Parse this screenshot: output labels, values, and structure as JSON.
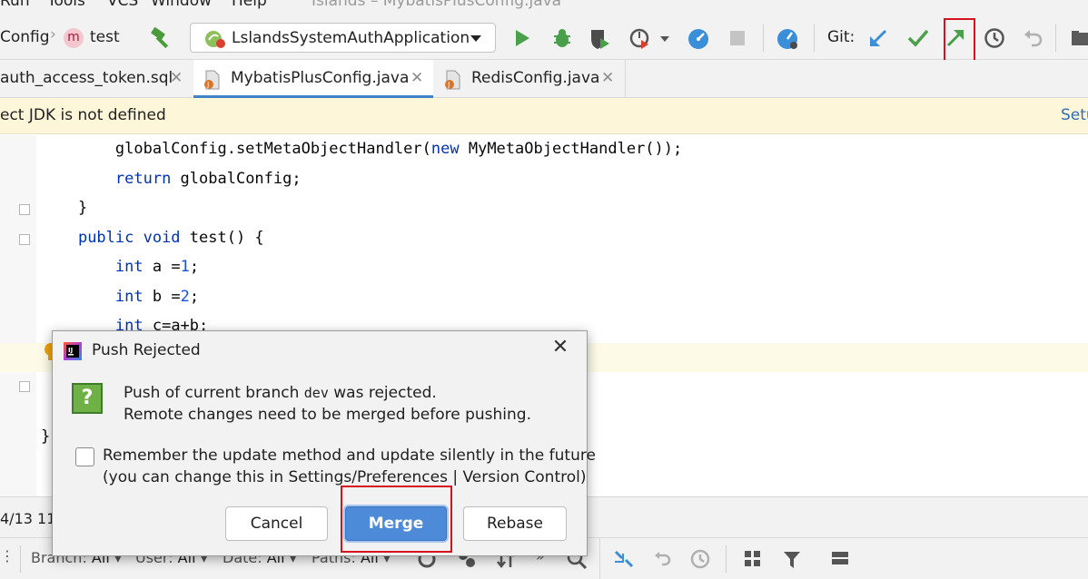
{
  "menu": {
    "items": [
      "Run",
      "Tools",
      "VCS",
      "Window",
      "Help"
    ],
    "window_title": "Islands – MybatisPlusConfig.java"
  },
  "toolbar": {
    "breadcrumb": [
      "Config",
      "test"
    ],
    "method_badge": "m",
    "run_config": "LslandsSystemAuthApplication",
    "git_label": "Git:"
  },
  "tabs": [
    {
      "label": "auth_access_token.sql",
      "active": false
    },
    {
      "label": "MybatisPlusConfig.java",
      "active": true
    },
    {
      "label": "RedisConfig.java",
      "active": false
    }
  ],
  "banner": {
    "message": "ect JDK is not defined",
    "link": "Setu"
  },
  "editor": {
    "lines": [
      {
        "indent": "        ",
        "parts": [
          [
            "",
            "globalConfig.setMetaObjectHandler("
          ],
          [
            "kw",
            "new"
          ],
          [
            "",
            " MyMetaObjectHandler());"
          ]
        ]
      },
      {
        "indent": "        ",
        "parts": [
          [
            "kw",
            "return"
          ],
          [
            "",
            " globalConfig;"
          ]
        ]
      },
      {
        "indent": "    ",
        "parts": [
          [
            "",
            "}"
          ]
        ]
      },
      {
        "indent": "    ",
        "parts": [
          [
            "kw",
            "public void"
          ],
          [
            "",
            " test() {"
          ]
        ]
      },
      {
        "indent": "        ",
        "parts": [
          [
            "kw",
            "int"
          ],
          [
            "",
            " a ="
          ],
          [
            "num",
            "1"
          ],
          [
            "",
            ";"
          ]
        ]
      },
      {
        "indent": "        ",
        "parts": [
          [
            "kw",
            "int"
          ],
          [
            "",
            " b ="
          ],
          [
            "num",
            "2"
          ],
          [
            "",
            ";"
          ]
        ]
      },
      {
        "indent": "        ",
        "parts": [
          [
            "kw",
            "int"
          ],
          [
            "",
            " c=a+b;"
          ]
        ]
      },
      {
        "indent": "",
        "parts": [
          [
            "",
            "}"
          ]
        ]
      }
    ]
  },
  "dialog": {
    "title": "Push Rejected",
    "message_prefix": "Push of current branch ",
    "branch": "dev",
    "message_suffix": " was rejected.",
    "message_line2": "Remote changes need to be merged before pushing.",
    "checkbox_line1": "Remember the update method and update silently in the future",
    "checkbox_line2": "(you can change this in Settings/Preferences | Version Control)",
    "checkbox_checked": false,
    "buttons": {
      "cancel": "Cancel",
      "merge": "Merge",
      "rebase": "Rebase"
    }
  },
  "bottom": {
    "date_fragment": "4/13 11",
    "filters": [
      {
        "name": "Branch:",
        "value": "All"
      },
      {
        "name": "User:",
        "value": "All"
      },
      {
        "name": "Date:",
        "value": "All"
      },
      {
        "name": "Paths:",
        "value": "All"
      }
    ]
  },
  "colors": {
    "highlight_box": "#d6121f",
    "merge_button": "#4d8ad8",
    "keyword": "#0033b3",
    "number": "#1750eb",
    "banner_bg": "#fdf6d8"
  }
}
